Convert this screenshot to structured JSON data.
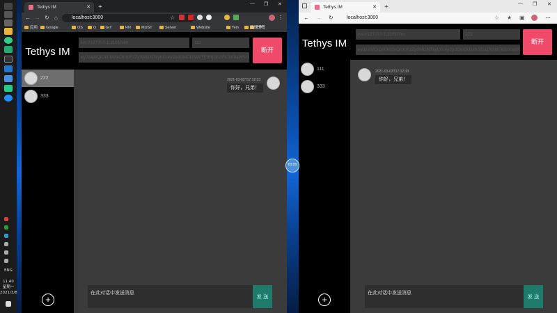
{
  "taskbar": {
    "lang": "ENG",
    "time": "11:40",
    "weekday": "星期一",
    "date": "2021/3/8"
  },
  "left": {
    "tab_title": "Tethys IM",
    "url": "localhost:3000",
    "bookmarks": [
      "应用",
      "Google",
      "OS",
      "O",
      "GIT",
      "RN",
      "MUST",
      "Server",
      "Website",
      "Yein",
      "无学",
      "其他书签"
    ],
    "brand": "Tethys IM",
    "server_placeholder": "ws://127.0.0.1:11010/im",
    "name_value": "111",
    "token_placeholder": "eyJzaWQiOiI0MzlxOHmFzZy9Mi1NTkyIn0.eyJpdGkiOiJlWkTE5RjJjNzFkSzI0aW5Hgd-Hd",
    "disconnect": "断开",
    "contacts": [
      {
        "name": "222"
      },
      {
        "name": "333"
      }
    ],
    "message": {
      "time": "2021-03-03T17:12:33",
      "text": "你好，兄弟！"
    },
    "input_placeholder": "在此对话中发送消息",
    "send": "发 送"
  },
  "right": {
    "tab_title": "Tethys IM",
    "url": "localhost:3000",
    "brand": "Tethys IM",
    "server_placeholder": "ws://127.0.0.1:11010/im",
    "name_value": "222",
    "token_placeholder": "eyJzaWQiOiI0MzlxOHmFzZy9Mi1NTkyIn0.eyJpdGkiOiJlWk1Eu2RjNzFkSzI0aW5Ho-Hd",
    "disconnect": "断开",
    "contacts": [
      {
        "name": "111"
      },
      {
        "name": "333"
      }
    ],
    "message": {
      "time": "2021-03-03T17:12:33",
      "text": "你好，兄弟！"
    },
    "input_placeholder": "在此对话中发送消息",
    "send": "发 送"
  },
  "divider": {
    "label": "00:05"
  }
}
